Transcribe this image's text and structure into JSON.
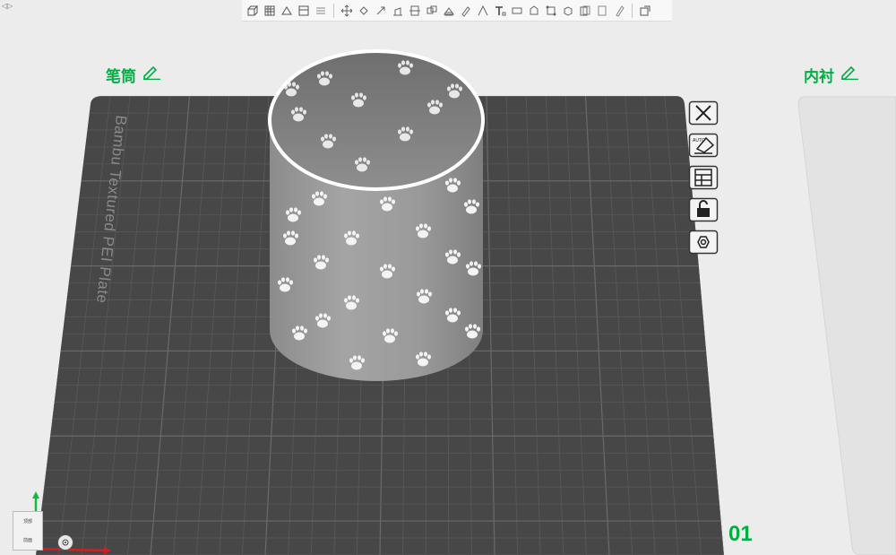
{
  "toolbar": {
    "groups": [
      [
        "add-icon",
        "arrange-icon",
        "orient-icon",
        "plate-icon",
        "plate-list-icon"
      ],
      [
        "move-icon",
        "rotate-icon",
        "scale-icon",
        "lay-on-face-icon",
        "cut-icon",
        "split-icon",
        "mesh-boolean-icon",
        "support-paint-icon",
        "seam-paint-icon",
        "text-icon",
        "measure-icon",
        "assemble-icon",
        "brim-ear-icon",
        "emboss-icon",
        "variable-layer-icon",
        "svg-icon",
        "color-paint-icon"
      ],
      [
        "view-icon"
      ]
    ]
  },
  "corner_mark": "◁▷",
  "plates": {
    "left": {
      "name": "笔筒"
    },
    "right": {
      "name": "内衬"
    }
  },
  "bed": {
    "label": "Bambu Textured PEI Plate",
    "plate_number": "01"
  },
  "side_tools": [
    "delete-plate-icon",
    "auto-orient-plate-icon",
    "arrange-plate-icon",
    "lock-plate-icon",
    "plate-settings-icon"
  ],
  "view_cube": {
    "top": "顶部",
    "front": "前面"
  },
  "colors": {
    "accent": "#00ae42",
    "bed": "#4a4a4a",
    "grid": "#5f5f5f",
    "model": "#9a9a9a"
  }
}
